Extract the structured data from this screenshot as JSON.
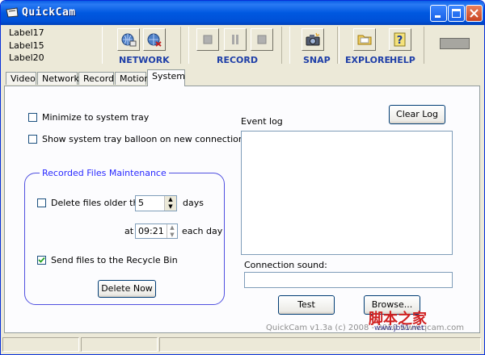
{
  "window": {
    "title": "QuickCam"
  },
  "toolbar": {
    "labels": [
      "Label17",
      "Label15",
      "Label20"
    ],
    "groups": {
      "network": "NETWORK",
      "record": "RECORD",
      "snap": "SNAP",
      "explore": "EXPLORE",
      "help": "HELP"
    }
  },
  "tabs": [
    "Video",
    "Network",
    "Record",
    "Motion",
    "System"
  ],
  "active_tab": "System",
  "system": {
    "minimize_to_tray": {
      "label": "Minimize to system tray",
      "checked": false
    },
    "tray_balloon": {
      "label": "Show system tray balloon on new connection",
      "checked": false
    },
    "maintenance": {
      "title": "Recorded Files Maintenance",
      "delete_older": {
        "label": "Delete files older than",
        "checked": false,
        "value": "5",
        "unit": "days"
      },
      "at_label": "at",
      "time_value": "09:21",
      "each_day": "each day",
      "recycle": {
        "label": "Send files to the Recycle Bin",
        "checked": true
      },
      "delete_now": "Delete Now"
    },
    "event_log": {
      "label": "Event log",
      "clear_button": "Clear Log"
    },
    "connection_sound": {
      "label": "Connection sound:",
      "value": ""
    },
    "test_button": "Test",
    "browse_button": "Browse..."
  },
  "footer": {
    "version": "QuickCam v1.3a  (c) 2008 - 2010 www.qcam.com"
  },
  "watermark": {
    "text": "脚本之家",
    "url": "www.jb51.net"
  },
  "colors": {
    "title_bar": "#0058e0",
    "group_border": "#5050e0",
    "group_title": "#2a2aff",
    "toolbar_label": "#1f3fa8"
  }
}
